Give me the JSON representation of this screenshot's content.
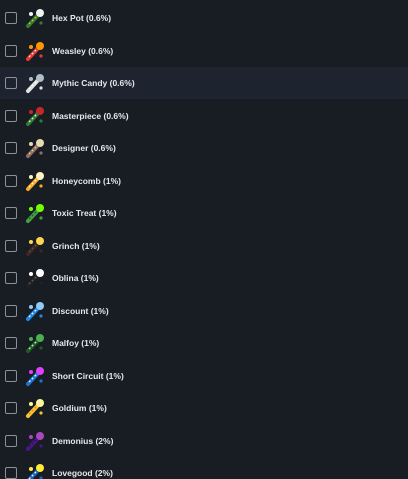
{
  "items": [
    {
      "label": "Hex Pot (0.6%)",
      "icon": "hex-pot-icon",
      "colors": [
        "#2e7d32",
        "#f2f2f2",
        "#f5c518"
      ]
    },
    {
      "label": "Weasley (0.6%)",
      "icon": "weasley-icon",
      "colors": [
        "#e53935",
        "#ff9800",
        "#f5f5f5"
      ]
    },
    {
      "label": "Mythic Candy (0.6%)",
      "icon": "mythic-candy-icon",
      "colors": [
        "#e0e0e0",
        "#b0bec5",
        "#ffffff"
      ]
    },
    {
      "label": "Masterpiece (0.6%)",
      "icon": "masterpiece-icon",
      "colors": [
        "#2e7d32",
        "#c62828",
        "#f0f0f0"
      ]
    },
    {
      "label": "Designer (0.6%)",
      "icon": "designer-icon",
      "colors": [
        "#8d6e63",
        "#e8d9b0",
        "#ffcc80"
      ]
    },
    {
      "label": "Honeycomb (1%)",
      "icon": "honeycomb-icon",
      "colors": [
        "#f9a825",
        "#fff3c4",
        "#ffffff"
      ]
    },
    {
      "label": "Toxic Treat (1%)",
      "icon": "toxic-treat-icon",
      "colors": [
        "#43a047",
        "#76ff03",
        "#1b5e20"
      ]
    },
    {
      "label": "Grinch (1%)",
      "icon": "grinch-icon",
      "colors": [
        "#3e2723",
        "#ffd54f",
        "#6d4c41"
      ]
    },
    {
      "label": "Oblina (1%)",
      "icon": "oblina-icon",
      "colors": [
        "#212121",
        "#ffffff",
        "#616161"
      ]
    },
    {
      "label": "Discount (1%)",
      "icon": "discount-icon",
      "colors": [
        "#1e88e5",
        "#90caf9",
        "#ffffff"
      ]
    },
    {
      "label": "Malfoy (1%)",
      "icon": "malfoy-icon",
      "colors": [
        "#1b5e20",
        "#4caf50",
        "#eeeeee"
      ]
    },
    {
      "label": "Short Circuit (1%)",
      "icon": "short-circuit-icon",
      "colors": [
        "#1976d2",
        "#e040fb",
        "#ffffff"
      ]
    },
    {
      "label": "Goldium (1%)",
      "icon": "goldium-icon",
      "colors": [
        "#fbc02d",
        "#fff59d",
        "#f57f17"
      ]
    },
    {
      "label": "Demonius (2%)",
      "icon": "demonius-icon",
      "colors": [
        "#4a148c",
        "#ab47bc",
        "#212121"
      ]
    },
    {
      "label": "Lovegood (2%)",
      "icon": "lovegood-icon",
      "colors": [
        "#1565c0",
        "#ffeb3b",
        "#ffffff"
      ]
    }
  ],
  "highlighted_index": 2
}
